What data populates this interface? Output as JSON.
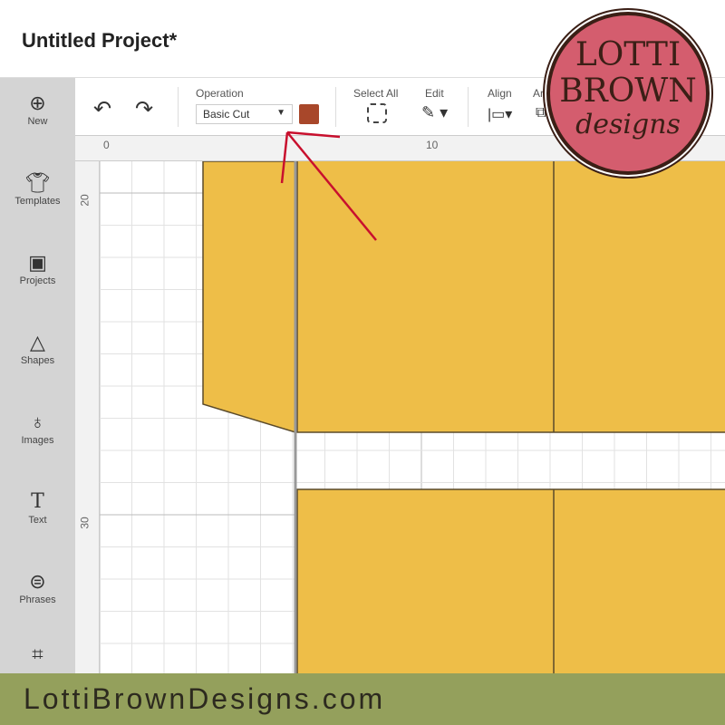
{
  "header": {
    "title": "Untitled Project*"
  },
  "sidebar": {
    "items": [
      {
        "label": "New",
        "icon": "plus-circle-icon"
      },
      {
        "label": "Templates",
        "icon": "tshirt-icon"
      },
      {
        "label": "Projects",
        "icon": "card-icon"
      },
      {
        "label": "Shapes",
        "icon": "shapes-icon"
      },
      {
        "label": "Images",
        "icon": "balloon-icon"
      },
      {
        "label": "Text",
        "icon": "text-icon"
      },
      {
        "label": "Phrases",
        "icon": "speech-bubble-icon"
      },
      {
        "label": "",
        "icon": "edit-image-icon"
      }
    ]
  },
  "toolbar": {
    "operation_label": "Operation",
    "operation_value": "Basic Cut",
    "color": "#a8472a",
    "select_all_label": "Select All",
    "edit_label": "Edit",
    "align_label": "Align",
    "arrange_label": "Ar"
  },
  "ruler": {
    "top": [
      "0",
      "10"
    ],
    "left": [
      "20",
      "30"
    ]
  },
  "canvas": {
    "shape_color": "#eebe48",
    "outline_color": "#5a4a2a",
    "arrow_color": "#c8102e"
  },
  "logo": {
    "line1": "LOTTI",
    "line2": "BROWN",
    "line3": "designs",
    "color": "#d45d6e"
  },
  "footer": {
    "text": "LottiBrownDesigns.com"
  }
}
